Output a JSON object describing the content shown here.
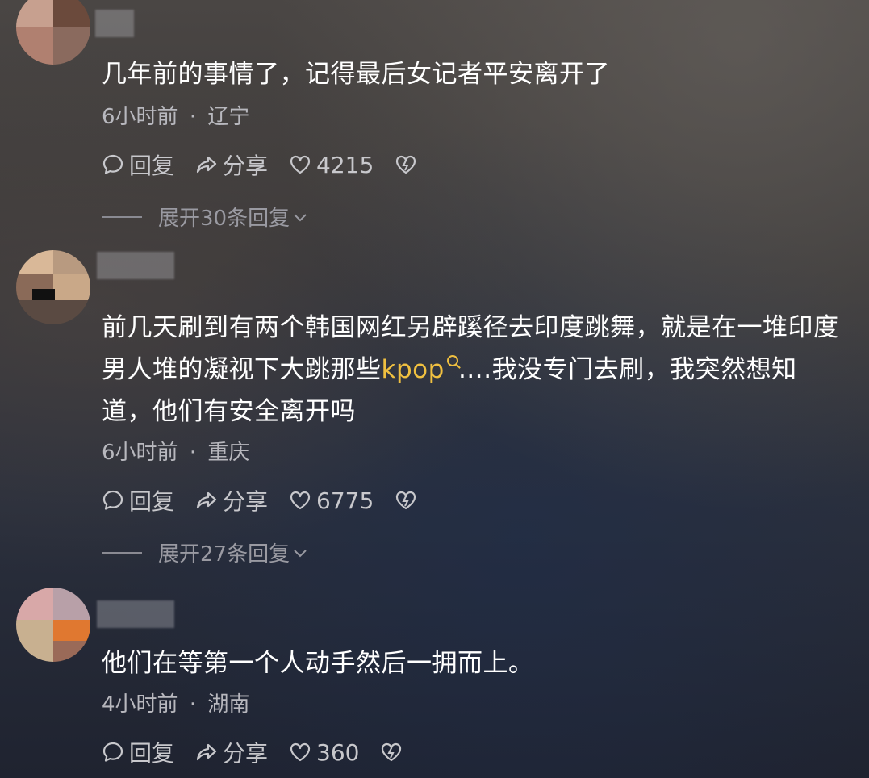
{
  "comments": [
    {
      "text": "几年前的事情了，记得最后女记者平安离开了",
      "time": "6小时前",
      "location": "辽宁",
      "reply_label": "回复",
      "share_label": "分享",
      "likes": "4215",
      "expand_label": "展开30条回复"
    },
    {
      "text_before": "前几天刷到有两个韩国网红另辟蹊径去印度跳舞，就是在一堆印度男人堆的凝视下大跳那些",
      "link_text": "kpop",
      "text_after": "….我没专门去刷，我突然想知道，他们有安全离开吗",
      "time": "6小时前",
      "location": "重庆",
      "reply_label": "回复",
      "share_label": "分享",
      "likes": "6775",
      "expand_label": "展开27条回复"
    },
    {
      "text": "他们在等第一个人动手然后一拥而上。",
      "time": "4小时前",
      "location": "湖南",
      "reply_label": "回复",
      "share_label": "分享",
      "likes": "360"
    }
  ],
  "meta_separator": "·",
  "colors": {
    "link": "#f0c040",
    "meta": "#b8b8be",
    "action": "#c8c8cc"
  },
  "icons": [
    "reply-icon",
    "share-icon",
    "like-icon",
    "dislike-icon",
    "chevron-down-icon",
    "search-icon"
  ]
}
